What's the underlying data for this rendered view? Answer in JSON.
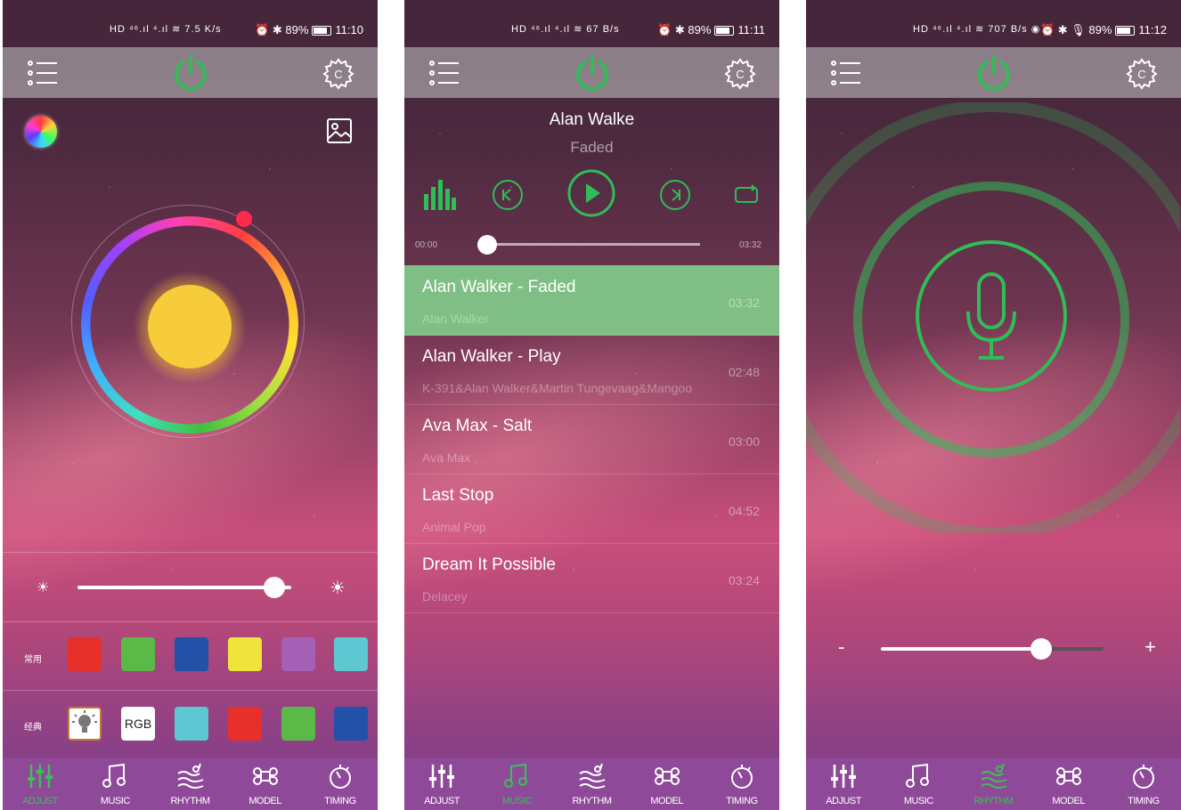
{
  "phones": [
    {
      "status": {
        "icons": "HD ⁴⁶.ıl ⁴.ıl ≋ 7.5 K/s",
        "right": "⏰ ✱ 89%",
        "time": "11:10"
      },
      "tabs": [
        {
          "label": "ADJUST",
          "icon": "sliders-icon",
          "active": true
        },
        {
          "label": "MUSIC",
          "icon": "music-note-icon",
          "active": false
        },
        {
          "label": "RHYTHM",
          "icon": "rhythm-icon",
          "active": false
        },
        {
          "label": "MODEL",
          "icon": "command-icon",
          "active": false
        },
        {
          "label": "TIMING",
          "icon": "timer-icon",
          "active": false
        }
      ]
    },
    {
      "status": {
        "icons": "HD ⁴⁶.ıl ⁴.ıl ≋ 67 B/s",
        "right": "⏰ ✱ 89%",
        "time": "11:11"
      },
      "tabs": [
        {
          "label": "ADJUST",
          "icon": "sliders-icon",
          "active": false
        },
        {
          "label": "MUSIC",
          "icon": "music-note-icon",
          "active": true
        },
        {
          "label": "RHYTHM",
          "icon": "rhythm-icon",
          "active": false
        },
        {
          "label": "MODEL",
          "icon": "command-icon",
          "active": false
        },
        {
          "label": "TIMING",
          "icon": "timer-icon",
          "active": false
        }
      ]
    },
    {
      "status": {
        "icons": "HD ⁴⁶.ıl ⁴.ıl ≋ 707 B/s ◉",
        "right": "⏰ ✱ 🎙 89%",
        "time": "11:12"
      },
      "tabs": [
        {
          "label": "ADJUST",
          "icon": "sliders-icon",
          "active": false
        },
        {
          "label": "MUSIC",
          "icon": "music-note-icon",
          "active": false
        },
        {
          "label": "RHYTHM",
          "icon": "rhythm-icon",
          "active": true
        },
        {
          "label": "MODEL",
          "icon": "command-icon",
          "active": false
        },
        {
          "label": "TIMING",
          "icon": "timer-icon",
          "active": false
        }
      ]
    }
  ],
  "adjust": {
    "brightness_value": 0.92,
    "common_label": "常用",
    "classic_label": "经典",
    "common_colors": [
      "#e8302a",
      "#5ab947",
      "#2451a8",
      "#f0e43c",
      "#a55fb4",
      "#5ec8d2"
    ],
    "classic_items": [
      {
        "type": "bulb",
        "label": ""
      },
      {
        "type": "rgb",
        "label": "RGB"
      },
      {
        "type": "color",
        "color": "#5ec8d2"
      },
      {
        "type": "color",
        "color": "#e8302a"
      },
      {
        "type": "color",
        "color": "#5ab947"
      },
      {
        "type": "color",
        "color": "#2451a8"
      }
    ]
  },
  "music": {
    "now_playing_title": "Alan Walke",
    "now_playing_subtitle": "Faded",
    "time_start": "00:00",
    "time_end": "03:32",
    "progress": 0.0,
    "songs": [
      {
        "title": "Alan Walker - Faded",
        "artist": "Alan Walker",
        "duration": "03:32",
        "active": true
      },
      {
        "title": "Alan Walker - Play",
        "artist": "K-391&Alan Walker&Martin Tungevaag&Mangoo",
        "duration": "02:48",
        "active": false
      },
      {
        "title": "Ava Max - Salt",
        "artist": "Ava Max",
        "duration": "03:00",
        "active": false
      },
      {
        "title": "Last Stop",
        "artist": "Animal Pop",
        "duration": "04:52",
        "active": false
      },
      {
        "title": "Dream It Possible",
        "artist": "Delacey",
        "duration": "03:24",
        "active": false
      }
    ]
  },
  "rhythm": {
    "minus_label": "-",
    "plus_label": "+",
    "sensitivity": 0.72
  },
  "colors": {
    "accent": "#2fbd57",
    "tabbar": "#8e4a99",
    "topbar": "#c8c8c8"
  }
}
